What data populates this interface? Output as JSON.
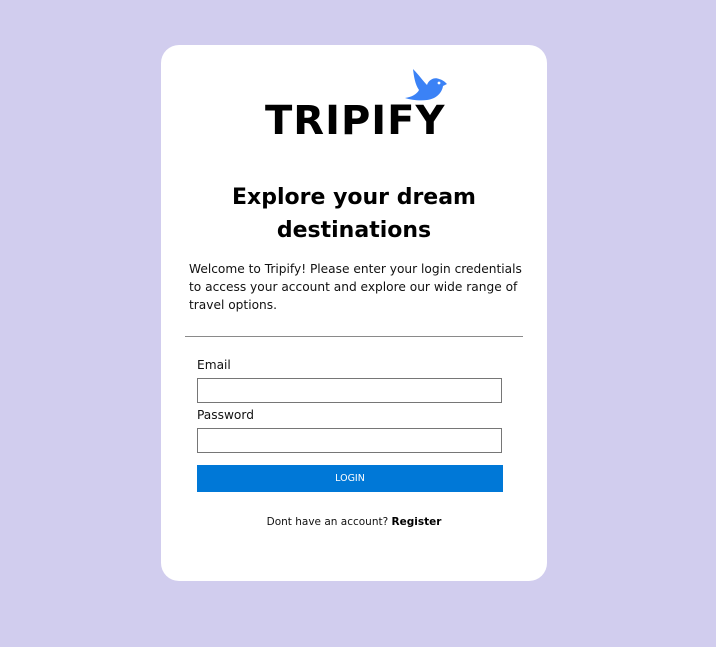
{
  "brand": {
    "name": "TRIPIFY",
    "logo_icon": "bird-icon",
    "icon_color": "#3b82f6"
  },
  "hero": {
    "headline_line1": "Explore your dream",
    "headline_line2": "destinations",
    "intro": "Welcome to Tripify! Please enter your login credentials to access your account and explore our wide range of travel options."
  },
  "form": {
    "email_label": "Email",
    "email_value": "",
    "password_label": "Password",
    "password_value": "",
    "login_label": "LOGIN"
  },
  "footer": {
    "prompt": "Dont have an account? ",
    "register_label": "Register"
  },
  "colors": {
    "background": "#d1cdee",
    "card": "#ffffff",
    "button": "#0078d7"
  }
}
